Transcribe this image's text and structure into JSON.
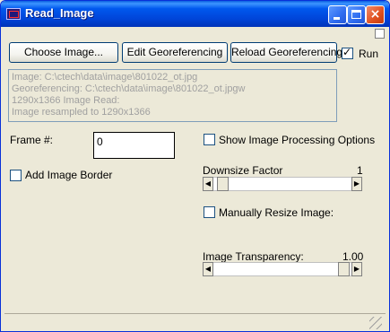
{
  "window": {
    "title": "Read_Image",
    "icon": "app-icon",
    "controls": {
      "minimize": "minimize-icon",
      "maximize": "maximize-icon",
      "close": "×"
    }
  },
  "toolbar": {
    "choose_label": "Choose Image...",
    "edit_label": "Edit Georeferencing",
    "reload_label": "Reload Georeferencing",
    "run_label": "Run",
    "run_checked": true
  },
  "info": {
    "lines": [
      "Image: C:\\ctech\\data\\image\\801022_ot.jpg",
      "Georeferencing: C:\\ctech\\data\\image\\801022_ot.jpgw",
      "1290x1366 Image Read:",
      "Image resampled to 1290x1366"
    ]
  },
  "frame": {
    "label": "Frame #:",
    "value": "0"
  },
  "options": {
    "add_border_label": "Add Image Border",
    "add_border_checked": false,
    "show_processing_label": "Show Image Processing Options",
    "show_processing_checked": false,
    "manual_resize_label": "Manually Resize Image:",
    "manual_resize_checked": false
  },
  "downsize": {
    "label": "Downsize Factor",
    "value": "1",
    "fraction": 0.0
  },
  "transparency": {
    "label": "Image Transparency:",
    "value": "1.00",
    "fraction": 1.0
  },
  "status": {
    "text": ""
  },
  "colors": {
    "title_bar": "#0054e3",
    "close_button": "#e0501e",
    "window_bg": "#ece9d8"
  }
}
